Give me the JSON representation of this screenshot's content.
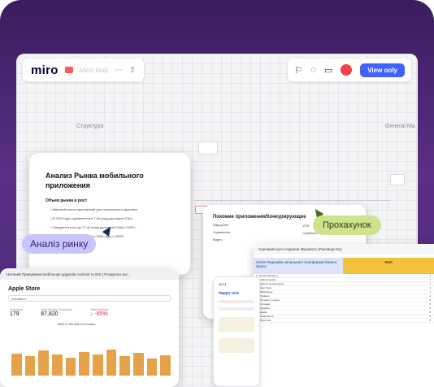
{
  "app": {
    "logo": "miro",
    "board_name": "Mind Map",
    "view_button": "View only"
  },
  "board": {
    "frame_structure": "Структура",
    "frame_general": "General Ma"
  },
  "doc": {
    "title": "Анализ Рынка мобильного приложения",
    "section": "Объем рынка и рост",
    "lines": [
      "• Мировой рынок приложений для психического здоровья",
      "• В 2024 году оценивается в 7,48 млрд долларов США.",
      "• Ожидается рост до 17,42 млрд долларов США к 2030 г.",
      "• 15,75 млрд долларов США к 2030 году с CAGR"
    ]
  },
  "tags": {
    "market_analysis": "Аналіз ринку",
    "walkthrough": "Прохахунок"
  },
  "store": {
    "header": "Нетаний Прихування мобільних додатків Android та iOS | Розкрутка зас...",
    "title": "Apple Store",
    "search": "meditation",
    "stats": [
      {
        "label": "Total Apps",
        "value": "179"
      },
      {
        "label": "Total Monthly Downloads",
        "value": "87,820"
      },
      {
        "label": "Total Revenue",
        "value": "↓ -85%"
      }
    ],
    "caption": "-85% in the last 12 months",
    "bars": [
      0.62,
      0.55,
      0.7,
      0.58,
      0.5,
      0.66,
      0.6,
      0.72,
      0.54,
      0.63,
      0.48,
      0.57
    ]
  },
  "overlap": {
    "title": "Похожие приложения/Конкурирующие",
    "lines": [
      "HappyOne",
      "Скриншоты",
      "Видео",
      "VOS",
      "Скриншоты"
    ]
  },
  "phone": {
    "time": "10:11",
    "logo": "happy one"
  },
  "sheet": {
    "title": "Сценарий для создания Звукового (Руководство)",
    "header_title": "UI/UX Редизайн начального платформи Games Space",
    "header_col": "Start",
    "rows": [
      [
        "1. Анализ Продукту",
        "1"
      ],
      [
        "1.1 Анализ рынку",
        "2"
      ],
      [
        "1.2 Анализ конкуренций",
        "2"
      ],
      [
        "1.3 User Flow",
        "3"
      ],
      [
        "2.1 Wireframes",
        "4"
      ],
      [
        "2.2 Главная",
        "4"
      ],
      [
        "2.3 Головна сторінка",
        "5"
      ],
      [
        "2.4 Сторінки",
        "5"
      ],
      [
        "2.5 Профіль",
        "6"
      ],
      [
        "3. Дизайн",
        "8"
      ],
      [
        "3.1 Компоненти",
        "8"
      ],
      [
        "3.2 Прототип",
        "9"
      ]
    ]
  }
}
